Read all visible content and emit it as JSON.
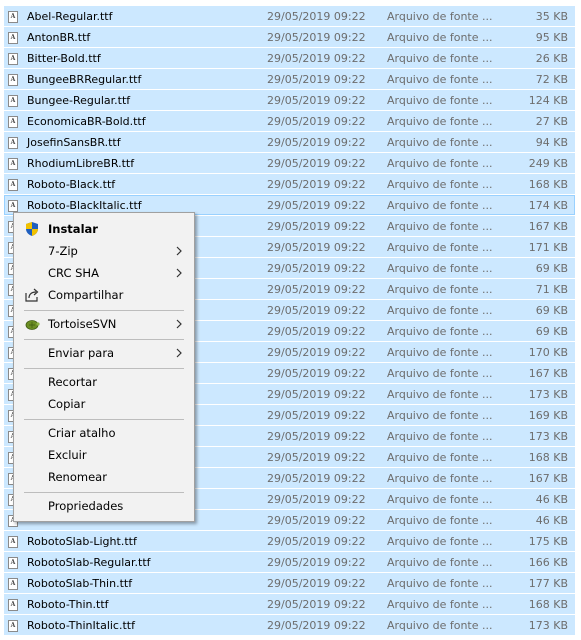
{
  "files": [
    {
      "name": "Abel-Regular.ttf",
      "date": "29/05/2019 09:22",
      "type": "Arquivo de fonte ...",
      "size": "35 KB"
    },
    {
      "name": "AntonBR.ttf",
      "date": "29/05/2019 09:22",
      "type": "Arquivo de fonte ...",
      "size": "95 KB"
    },
    {
      "name": "Bitter-Bold.ttf",
      "date": "29/05/2019 09:22",
      "type": "Arquivo de fonte ...",
      "size": "26 KB"
    },
    {
      "name": "BungeeBRRegular.ttf",
      "date": "29/05/2019 09:22",
      "type": "Arquivo de fonte ...",
      "size": "72 KB"
    },
    {
      "name": "Bungee-Regular.ttf",
      "date": "29/05/2019 09:22",
      "type": "Arquivo de fonte ...",
      "size": "124 KB"
    },
    {
      "name": "EconomicaBR-Bold.ttf",
      "date": "29/05/2019 09:22",
      "type": "Arquivo de fonte ...",
      "size": "27 KB"
    },
    {
      "name": "JosefinSansBR.ttf",
      "date": "29/05/2019 09:22",
      "type": "Arquivo de fonte ...",
      "size": "94 KB"
    },
    {
      "name": "RhodiumLibreBR.ttf",
      "date": "29/05/2019 09:22",
      "type": "Arquivo de fonte ...",
      "size": "249 KB"
    },
    {
      "name": "Roboto-Black.ttf",
      "date": "29/05/2019 09:22",
      "type": "Arquivo de fonte ...",
      "size": "168 KB"
    },
    {
      "name": "Roboto-BlackItalic.ttf",
      "date": "29/05/2019 09:22",
      "type": "Arquivo de fonte ...",
      "size": "174 KB"
    },
    {
      "name": "",
      "date": "29/05/2019 09:22",
      "type": "Arquivo de fonte ...",
      "size": "167 KB"
    },
    {
      "name": "",
      "date": "29/05/2019 09:22",
      "type": "Arquivo de fonte ...",
      "size": "171 KB"
    },
    {
      "name": "",
      "date": "29/05/2019 09:22",
      "type": "Arquivo de fonte ...",
      "size": "69 KB"
    },
    {
      "name": "",
      "date": "29/05/2019 09:22",
      "type": "Arquivo de fonte ...",
      "size": "71 KB"
    },
    {
      "name": "",
      "date": "29/05/2019 09:22",
      "type": "Arquivo de fonte ...",
      "size": "69 KB"
    },
    {
      "name": "",
      "date": "29/05/2019 09:22",
      "type": "Arquivo de fonte ...",
      "size": "69 KB"
    },
    {
      "name": "",
      "date": "29/05/2019 09:22",
      "type": "Arquivo de fonte ...",
      "size": "170 KB"
    },
    {
      "name": "",
      "date": "29/05/2019 09:22",
      "type": "Arquivo de fonte ...",
      "size": "167 KB"
    },
    {
      "name": "",
      "date": "29/05/2019 09:22",
      "type": "Arquivo de fonte ...",
      "size": "173 KB"
    },
    {
      "name": "",
      "date": "29/05/2019 09:22",
      "type": "Arquivo de fonte ...",
      "size": "169 KB"
    },
    {
      "name": "",
      "date": "29/05/2019 09:22",
      "type": "Arquivo de fonte ...",
      "size": "173 KB"
    },
    {
      "name": "",
      "date": "29/05/2019 09:22",
      "type": "Arquivo de fonte ...",
      "size": "168 KB"
    },
    {
      "name": "",
      "date": "29/05/2019 09:22",
      "type": "Arquivo de fonte ...",
      "size": "167 KB"
    },
    {
      "name": "",
      "date": "29/05/2019 09:22",
      "type": "Arquivo de fonte ...",
      "size": "46 KB"
    },
    {
      "name": "",
      "date": "29/05/2019 09:22",
      "type": "Arquivo de fonte ...",
      "size": "46 KB"
    },
    {
      "name": "RobotoSlab-Light.ttf",
      "date": "29/05/2019 09:22",
      "type": "Arquivo de fonte ...",
      "size": "175 KB"
    },
    {
      "name": "RobotoSlab-Regular.ttf",
      "date": "29/05/2019 09:22",
      "type": "Arquivo de fonte ...",
      "size": "166 KB"
    },
    {
      "name": "RobotoSlab-Thin.ttf",
      "date": "29/05/2019 09:22",
      "type": "Arquivo de fonte ...",
      "size": "177 KB"
    },
    {
      "name": "Roboto-Thin.ttf",
      "date": "29/05/2019 09:22",
      "type": "Arquivo de fonte ...",
      "size": "168 KB"
    },
    {
      "name": "Roboto-ThinItalic.ttf",
      "date": "29/05/2019 09:22",
      "type": "Arquivo de fonte ...",
      "size": "173 KB"
    }
  ],
  "focused_index": 9,
  "file_icon_glyph": "A",
  "menu": {
    "install": "Instalar",
    "zip": "7-Zip",
    "crc": "CRC SHA",
    "share": "Compartilhar",
    "tortoise": "TortoiseSVN",
    "send_to": "Enviar para",
    "cut": "Recortar",
    "copy": "Copiar",
    "shortcut": "Criar atalho",
    "delete": "Excluir",
    "rename": "Renomear",
    "properties": "Propriedades"
  },
  "icons": {
    "install": "shield-icon",
    "share": "share-icon",
    "tortoise": "tortoise-icon",
    "submenu": "chevron-right-icon"
  },
  "colors": {
    "selection": "#cce8ff",
    "focus_border": "#99d1ff",
    "menu_bg": "#f2f2f2",
    "shield_blue": "#1f5fbf",
    "shield_yellow": "#f2c200"
  }
}
